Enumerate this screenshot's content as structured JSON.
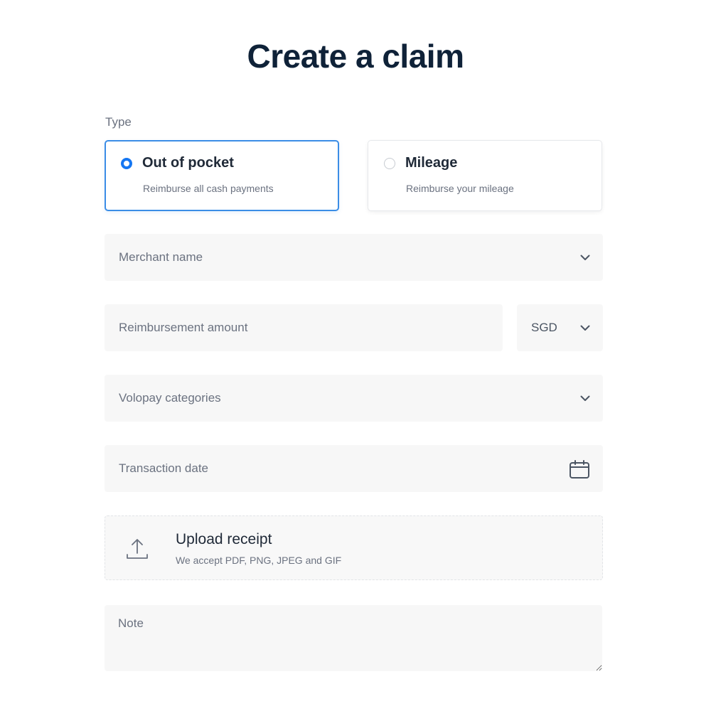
{
  "page": {
    "title": "Create a claim"
  },
  "type": {
    "label": "Type",
    "options": [
      {
        "title": "Out of pocket",
        "description": "Reimburse all cash payments",
        "selected": true
      },
      {
        "title": "Mileage",
        "description": "Reimburse your mileage",
        "selected": false
      }
    ]
  },
  "fields": {
    "merchant": {
      "placeholder": "Merchant name",
      "icon": "chevron-down-icon"
    },
    "amount": {
      "placeholder": "Reimbursement amount"
    },
    "currency": {
      "value": "SGD",
      "icon": "chevron-down-icon"
    },
    "categories": {
      "placeholder": "Volopay categories",
      "icon": "chevron-down-icon"
    },
    "date": {
      "placeholder": "Transaction date",
      "icon": "calendar-icon"
    }
  },
  "upload": {
    "title": "Upload receipt",
    "description": "We accept PDF, PNG, JPEG and GIF",
    "icon": "upload-icon"
  },
  "note": {
    "placeholder": "Note"
  },
  "colors": {
    "accent": "#1677f2",
    "selected_border": "#3b8de6",
    "title": "#0f2238",
    "field_bg": "#f7f7f7"
  }
}
